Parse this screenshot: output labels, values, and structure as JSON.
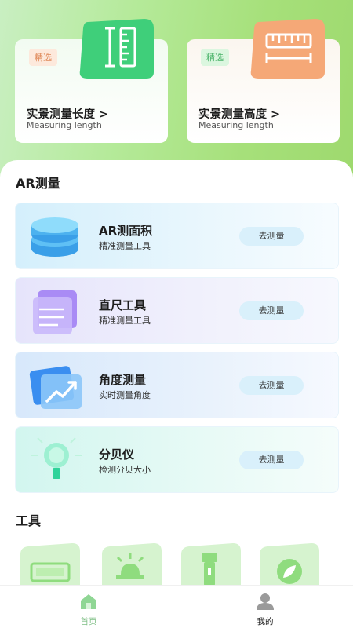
{
  "hero_cards": [
    {
      "badge": "精选",
      "title": "实景测量长度 >",
      "subtitle": "Measuring length",
      "icon": "ruler-icon"
    },
    {
      "badge": "精选",
      "title": "实景测量高度  >",
      "subtitle": "Measuring length",
      "icon": "height-ruler-icon"
    }
  ],
  "ar_section": {
    "title": "AR测量",
    "items": [
      {
        "name": "AR测面积",
        "desc": "精准测量工具",
        "button": "去测量",
        "icon": "area-stack-icon"
      },
      {
        "name": "直尺工具",
        "desc": "精准测量工具",
        "button": "去测量",
        "icon": "ruler-doc-icon"
      },
      {
        "name": "角度测量",
        "desc": "实时测量角度",
        "button": "去测量",
        "icon": "angle-chart-icon"
      },
      {
        "name": "分贝仪",
        "desc": "检测分贝大小",
        "button": "去测量",
        "icon": "bulb-decibel-icon"
      }
    ]
  },
  "tools_section": {
    "title": "工具",
    "tiles": [
      "battery-icon",
      "alarm-light-icon",
      "flashlight-icon",
      "leaf-icon"
    ]
  },
  "bottom_nav": {
    "home": "首页",
    "mine": "我的"
  },
  "colors": {
    "accent_green": "#7fbf86",
    "top_gradient": "#a6e07a",
    "button_bg": "#d9f0fb"
  }
}
